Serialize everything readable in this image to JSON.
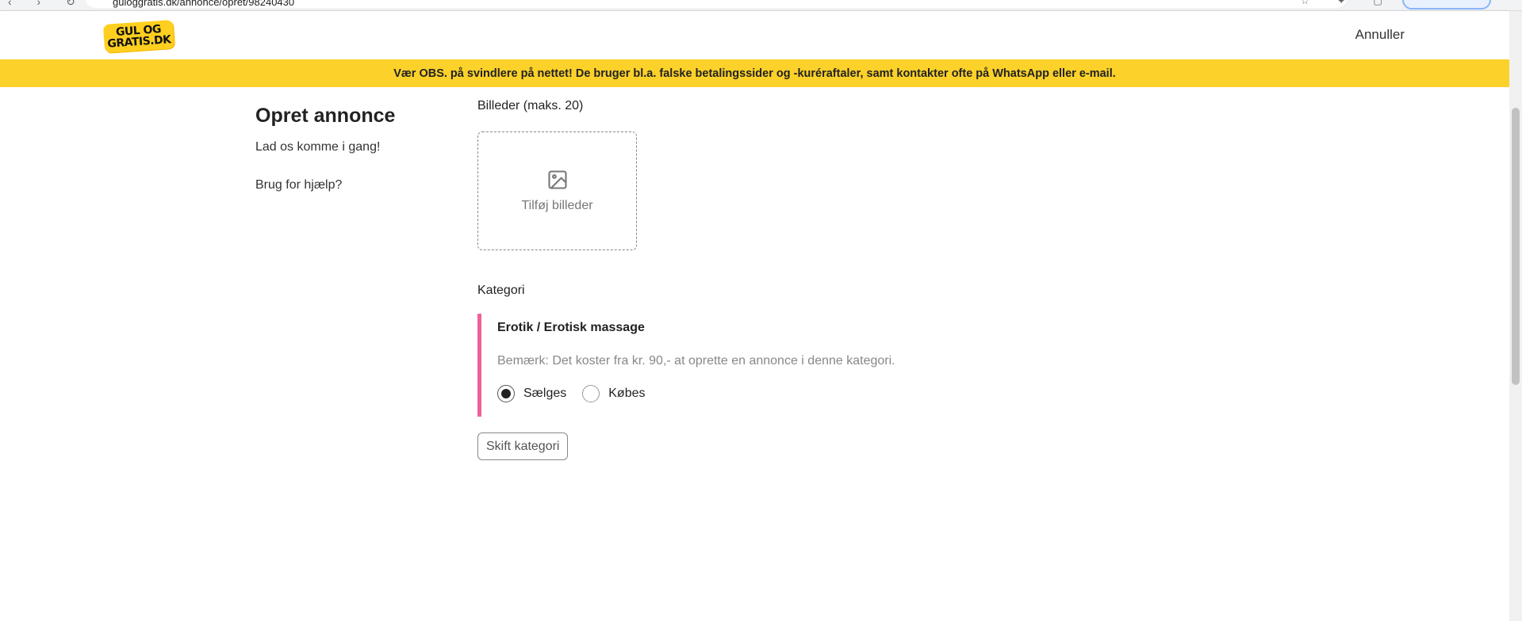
{
  "browser": {
    "url_visible": "guloggratis.dk/annonce/opret/98240430"
  },
  "header": {
    "logo_line1": "GUL OG",
    "logo_line2": "GRATIS.DK",
    "cancel_label": "Annuller"
  },
  "banner": {
    "text": "Vær OBS. på svindlere på nettet! De bruger bl.a. falske betalingssider og -kuréraftaler, samt kontakter ofte på WhatsApp eller e-mail.",
    "color": "#fcd12a"
  },
  "sidebar": {
    "title": "Opret annonce",
    "subtitle": "Lad os komme i gang!",
    "help_link": "Brug for hjælp?"
  },
  "images": {
    "label": "Billeder (maks. 20)",
    "add_label": "Tilføj billeder",
    "icon": "image-icon"
  },
  "category": {
    "label": "Kategori",
    "name": "Erotik / Erotisk massage",
    "note": "Bemærk: Det koster fra kr. 90,- at oprette en annonce i denne kategori.",
    "accent_color": "#f0609a",
    "options": [
      {
        "label": "Sælges",
        "checked": true
      },
      {
        "label": "Købes",
        "checked": false
      }
    ],
    "switch_button": "Skift kategori"
  }
}
